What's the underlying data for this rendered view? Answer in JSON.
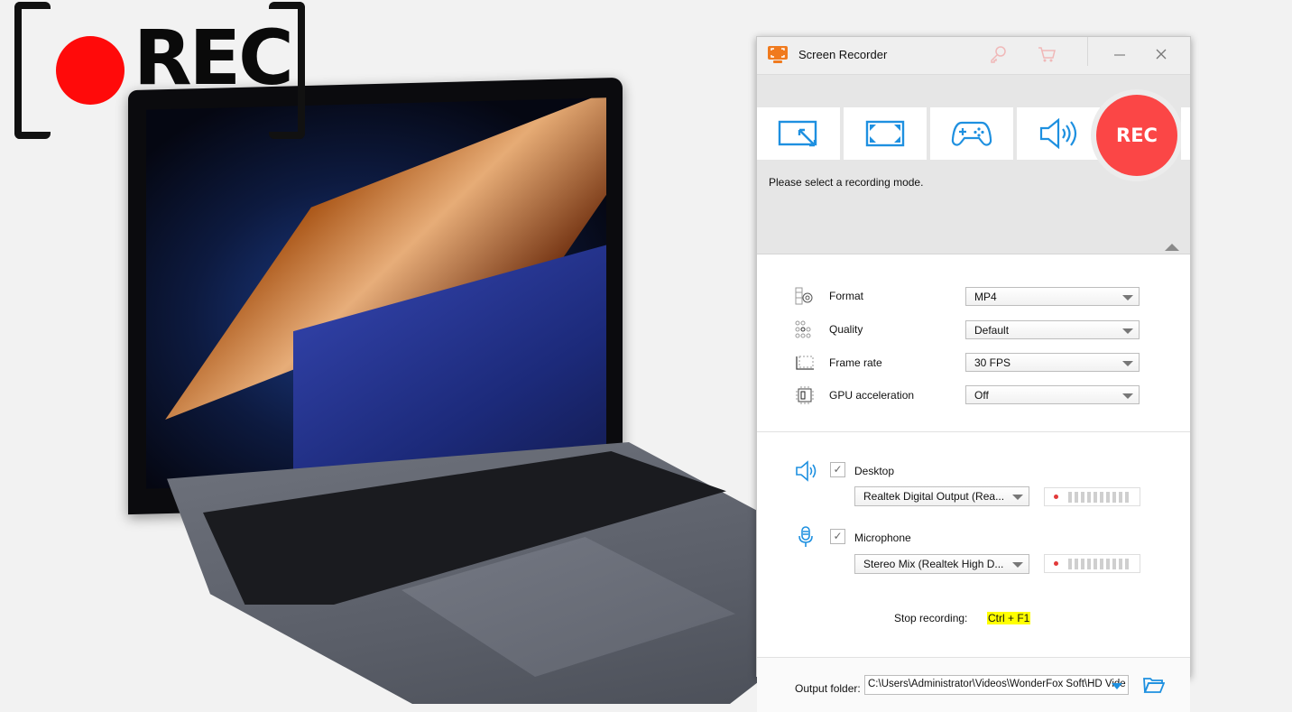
{
  "background": {
    "logo_text": "REC",
    "colors": {
      "rec_dot": "#ff0a0a",
      "bracket": "#111111"
    }
  },
  "window": {
    "title": "Screen Recorder",
    "titlebar_icons": [
      "key-icon",
      "cart-icon",
      "minimize-icon",
      "close-icon"
    ],
    "colors": {
      "accent": "#1e90e0",
      "rec": "#fb4646",
      "app_icon": "#f07a1e",
      "hotkey_highlight": "#ffff00"
    }
  },
  "modes": {
    "buttons": [
      {
        "name": "region-mode",
        "icon": "region-resize-icon"
      },
      {
        "name": "fullscreen-mode",
        "icon": "fullscreen-icon"
      },
      {
        "name": "game-mode",
        "icon": "gamepad-icon"
      },
      {
        "name": "audio-only-mode",
        "icon": "speaker-icon"
      }
    ],
    "rec_label": "REC",
    "hint": "Please select a recording mode."
  },
  "settings": {
    "rows": [
      {
        "label": "Format",
        "value": "MP4",
        "icon": "format-gear-icon"
      },
      {
        "label": "Quality",
        "value": "Default",
        "icon": "quality-dots-icon"
      },
      {
        "label": "Frame rate",
        "value": "30 FPS",
        "icon": "frame-rate-icon"
      },
      {
        "label": "GPU acceleration",
        "value": "Off",
        "icon": "gpu-chip-icon"
      }
    ]
  },
  "audio": {
    "desktop": {
      "label": "Desktop",
      "checked": true,
      "device": "Realtek Digital Output (Rea..."
    },
    "microphone": {
      "label": "Microphone",
      "checked": true,
      "device": "Stereo Mix (Realtek High D..."
    },
    "check_glyph": "✓",
    "stop_label": "Stop recording:",
    "stop_hotkey": "Ctrl + F1"
  },
  "output": {
    "label": "Output folder:",
    "path": "C:\\Users\\Administrator\\Videos\\WonderFox Soft\\HD Vide"
  }
}
